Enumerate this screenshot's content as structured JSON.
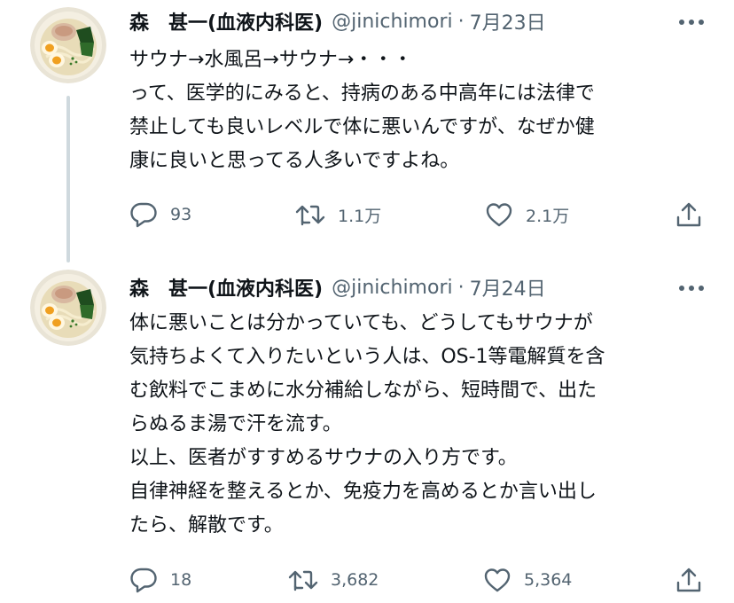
{
  "tweets": [
    {
      "author_name": "森　甚一(血液内科医)",
      "handle": "@jinichimori",
      "separator": "·",
      "date": "7月23日",
      "lines": [
        "サウナ→水風呂→サウナ→・・・",
        "って、医学的にみると、持病のある中高年には法律で",
        "禁止しても良いレベルで体に悪いんですが、なぜか健",
        "康に良いと思ってる人多いですよね。"
      ],
      "stats": {
        "replies": "93",
        "retweets": "1.1万",
        "likes": "2.1万"
      }
    },
    {
      "author_name": "森　甚一(血液内科医)",
      "handle": "@jinichimori",
      "separator": "·",
      "date": "7月24日",
      "lines": [
        "体に悪いことは分かっていても、どうしてもサウナが",
        "気持ちよくて入りたいという人は、OS-1等電解質を含",
        "む飲料でこまめに水分補給しながら、短時間で、出た",
        "らぬるま湯で汗を流す。",
        "以上、医者がすすめるサウナの入り方です。",
        "自律神経を整えるとか、免疫力を高めるとか言い出し",
        "たら、解散です。"
      ],
      "stats": {
        "replies": "18",
        "retweets": "3,682",
        "likes": "5,364"
      }
    }
  ],
  "icons": {
    "more": "more-horizontal-icon",
    "reply": "reply-bubble-icon",
    "retweet": "retweet-icon",
    "like": "heart-icon",
    "share": "share-upload-icon"
  },
  "colors": {
    "text": "#0f1419",
    "secondary": "#536471",
    "thread_line": "#cfd9de"
  }
}
